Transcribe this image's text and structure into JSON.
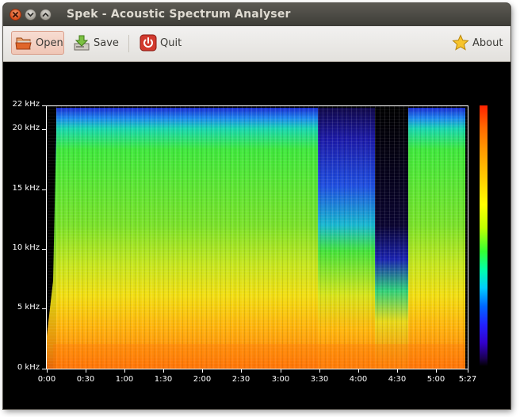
{
  "window": {
    "title": "Spek - Acoustic Spectrum Analyser"
  },
  "toolbar": {
    "open_label": "Open",
    "save_label": "Save",
    "quit_label": "Quit",
    "about_label": "About"
  },
  "spectrogram": {
    "y_ticks": [
      "22 kHz",
      "20 kHz",
      "15 kHz",
      "10 kHz",
      "5 kHz",
      "0 kHz"
    ],
    "x_ticks": [
      "0:00",
      "0:30",
      "1:00",
      "1:30",
      "2:00",
      "2:30",
      "3:00",
      "3:30",
      "4:00",
      "4:30",
      "5:00",
      "5:27"
    ]
  },
  "colors": {
    "titlebar": "#3c3b37",
    "toolbar": "#f2f1f0",
    "plot_background": "#000000",
    "open_button_highlight": "#f0c6b6"
  },
  "icons": [
    "window-close-icon",
    "window-minimize-icon",
    "window-maximize-icon",
    "open-folder-icon",
    "save-icon",
    "quit-power-icon",
    "about-star-icon"
  ]
}
